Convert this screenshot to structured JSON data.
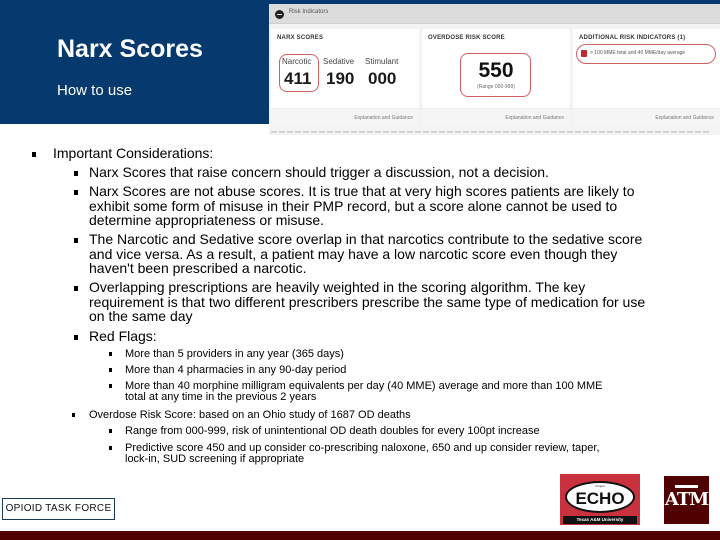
{
  "header": {
    "title": "Narx Scores",
    "subtitle": "How to use"
  },
  "embedded_screenshot": {
    "bar_label": "Risk Indicators",
    "narx_panel": {
      "title": "NARX SCORES",
      "scores": [
        {
          "label": "Narcotic",
          "value": "411"
        },
        {
          "label": "Sedative",
          "value": "190"
        },
        {
          "label": "Stimulant",
          "value": "000"
        }
      ],
      "footer_link": "Explanation and Guidance"
    },
    "overdose_panel": {
      "title": "OVERDOSE RISK SCORE",
      "value": "550",
      "range": "(Range 000-999)",
      "footer_link": "Explanation and Guidance"
    },
    "additional_panel": {
      "title": "ADDITIONAL RISK INDICATORS (1)",
      "indicator": "> 100 MME total and 40 MME/day average",
      "footer_link": "Explanation and Guidance"
    }
  },
  "body": {
    "heading": "Important Considerations:",
    "considerations": [
      "Narx Scores that raise concern should trigger a discussion, not a decision.",
      "Narx Scores are not abuse scores. It is true that at very high scores patients are likely to exhibit some form of misuse in their PMP record, but a score alone cannot be used to determine appropriateness or misuse.",
      "The Narcotic and Sedative score overlap in that narcotics contribute to the sedative score and vice versa. As a result, a patient may have a low narcotic score even though they haven't been prescribed a narcotic.",
      "Overlapping prescriptions are heavily weighted in the scoring algorithm. The key requirement is that two different prescribers prescribe the same type of medication for use on the same day",
      "Red Flags:"
    ],
    "red_flags": [
      "More than 5 providers in any year (365 days)",
      "More than 4 pharmacies in any 90-day period",
      "More than 40 morphine milligram equivalents per day (40 MME) average and more than 100 MME total at any time in the previous 2 years"
    ],
    "overdose_heading": "Overdose Risk Score: based on an Ohio study of 1687 OD deaths",
    "overdose_points": [
      "Range from 000-999, risk of unintentional OD death doubles for every 100pt increase",
      "Predictive score  450 and up consider co-prescribing naloxone, 650 and up consider review, taper, lock-in, SUD screening if appropriate"
    ]
  },
  "footer": {
    "task_force_label": "OPIOID TASK FORCE",
    "echo_logo": {
      "top": "Project",
      "main": "ECHO",
      "bottom": "Texas A&M University"
    },
    "atm_logo": "ATM",
    "colors": {
      "maroon": "#500000",
      "navy": "#063a6e",
      "echo_red": "#c8313d"
    }
  }
}
